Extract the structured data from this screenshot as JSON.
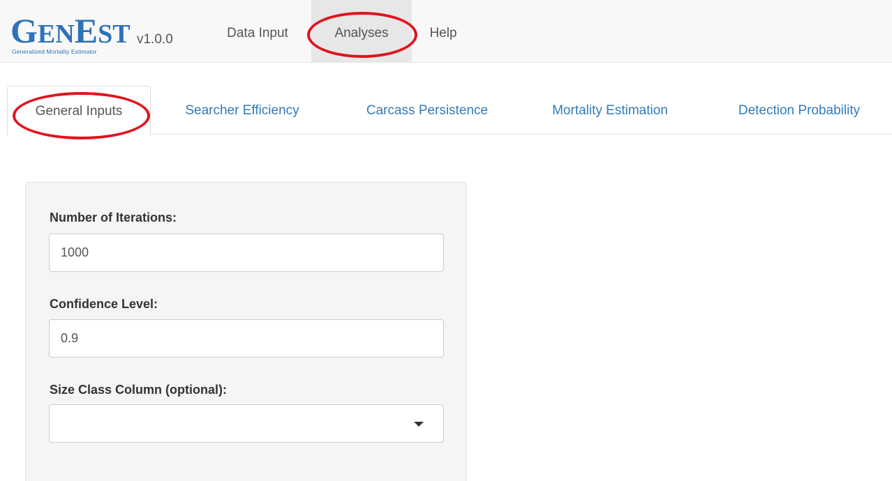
{
  "navbar": {
    "logo_text": "GenEst",
    "logo_subtitle": "Generalized Mortality Estimator",
    "version": "v1.0.0",
    "items": [
      {
        "label": "Data Input",
        "active": false
      },
      {
        "label": "Analyses",
        "active": true
      },
      {
        "label": "Help",
        "active": false
      }
    ]
  },
  "tabs": [
    {
      "label": "General Inputs",
      "active": true
    },
    {
      "label": "Searcher Efficiency",
      "active": false
    },
    {
      "label": "Carcass Persistence",
      "active": false
    },
    {
      "label": "Mortality Estimation",
      "active": false
    },
    {
      "label": "Detection Probability",
      "active": false
    }
  ],
  "form": {
    "iterations": {
      "label": "Number of Iterations:",
      "value": "1000"
    },
    "confidence": {
      "label": "Confidence Level:",
      "value": "0.9"
    },
    "size_class": {
      "label": "Size Class Column (optional):",
      "value": ""
    }
  },
  "annotations": {
    "color": "#e0141e",
    "highlighted": [
      "Analyses",
      "General Inputs"
    ]
  },
  "colors": {
    "brand": "#2f72b8",
    "link": "#337ab7",
    "navbar_bg": "#f8f8f8",
    "well_bg": "#f5f5f5"
  }
}
